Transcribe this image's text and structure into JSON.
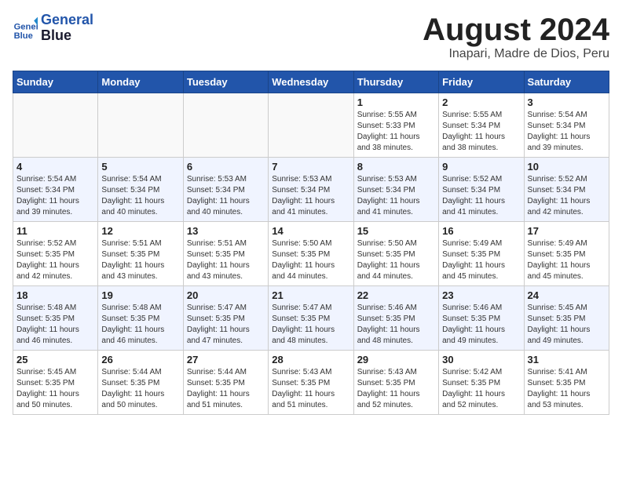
{
  "header": {
    "logo_line1": "General",
    "logo_line2": "Blue",
    "month_title": "August 2024",
    "subtitle": "Inapari, Madre de Dios, Peru"
  },
  "weekdays": [
    "Sunday",
    "Monday",
    "Tuesday",
    "Wednesday",
    "Thursday",
    "Friday",
    "Saturday"
  ],
  "weeks": [
    [
      {
        "day": "",
        "info": ""
      },
      {
        "day": "",
        "info": ""
      },
      {
        "day": "",
        "info": ""
      },
      {
        "day": "",
        "info": ""
      },
      {
        "day": "1",
        "info": "Sunrise: 5:55 AM\nSunset: 5:33 PM\nDaylight: 11 hours\nand 38 minutes."
      },
      {
        "day": "2",
        "info": "Sunrise: 5:55 AM\nSunset: 5:34 PM\nDaylight: 11 hours\nand 38 minutes."
      },
      {
        "day": "3",
        "info": "Sunrise: 5:54 AM\nSunset: 5:34 PM\nDaylight: 11 hours\nand 39 minutes."
      }
    ],
    [
      {
        "day": "4",
        "info": "Sunrise: 5:54 AM\nSunset: 5:34 PM\nDaylight: 11 hours\nand 39 minutes."
      },
      {
        "day": "5",
        "info": "Sunrise: 5:54 AM\nSunset: 5:34 PM\nDaylight: 11 hours\nand 40 minutes."
      },
      {
        "day": "6",
        "info": "Sunrise: 5:53 AM\nSunset: 5:34 PM\nDaylight: 11 hours\nand 40 minutes."
      },
      {
        "day": "7",
        "info": "Sunrise: 5:53 AM\nSunset: 5:34 PM\nDaylight: 11 hours\nand 41 minutes."
      },
      {
        "day": "8",
        "info": "Sunrise: 5:53 AM\nSunset: 5:34 PM\nDaylight: 11 hours\nand 41 minutes."
      },
      {
        "day": "9",
        "info": "Sunrise: 5:52 AM\nSunset: 5:34 PM\nDaylight: 11 hours\nand 41 minutes."
      },
      {
        "day": "10",
        "info": "Sunrise: 5:52 AM\nSunset: 5:34 PM\nDaylight: 11 hours\nand 42 minutes."
      }
    ],
    [
      {
        "day": "11",
        "info": "Sunrise: 5:52 AM\nSunset: 5:35 PM\nDaylight: 11 hours\nand 42 minutes."
      },
      {
        "day": "12",
        "info": "Sunrise: 5:51 AM\nSunset: 5:35 PM\nDaylight: 11 hours\nand 43 minutes."
      },
      {
        "day": "13",
        "info": "Sunrise: 5:51 AM\nSunset: 5:35 PM\nDaylight: 11 hours\nand 43 minutes."
      },
      {
        "day": "14",
        "info": "Sunrise: 5:50 AM\nSunset: 5:35 PM\nDaylight: 11 hours\nand 44 minutes."
      },
      {
        "day": "15",
        "info": "Sunrise: 5:50 AM\nSunset: 5:35 PM\nDaylight: 11 hours\nand 44 minutes."
      },
      {
        "day": "16",
        "info": "Sunrise: 5:49 AM\nSunset: 5:35 PM\nDaylight: 11 hours\nand 45 minutes."
      },
      {
        "day": "17",
        "info": "Sunrise: 5:49 AM\nSunset: 5:35 PM\nDaylight: 11 hours\nand 45 minutes."
      }
    ],
    [
      {
        "day": "18",
        "info": "Sunrise: 5:48 AM\nSunset: 5:35 PM\nDaylight: 11 hours\nand 46 minutes."
      },
      {
        "day": "19",
        "info": "Sunrise: 5:48 AM\nSunset: 5:35 PM\nDaylight: 11 hours\nand 46 minutes."
      },
      {
        "day": "20",
        "info": "Sunrise: 5:47 AM\nSunset: 5:35 PM\nDaylight: 11 hours\nand 47 minutes."
      },
      {
        "day": "21",
        "info": "Sunrise: 5:47 AM\nSunset: 5:35 PM\nDaylight: 11 hours\nand 48 minutes."
      },
      {
        "day": "22",
        "info": "Sunrise: 5:46 AM\nSunset: 5:35 PM\nDaylight: 11 hours\nand 48 minutes."
      },
      {
        "day": "23",
        "info": "Sunrise: 5:46 AM\nSunset: 5:35 PM\nDaylight: 11 hours\nand 49 minutes."
      },
      {
        "day": "24",
        "info": "Sunrise: 5:45 AM\nSunset: 5:35 PM\nDaylight: 11 hours\nand 49 minutes."
      }
    ],
    [
      {
        "day": "25",
        "info": "Sunrise: 5:45 AM\nSunset: 5:35 PM\nDaylight: 11 hours\nand 50 minutes."
      },
      {
        "day": "26",
        "info": "Sunrise: 5:44 AM\nSunset: 5:35 PM\nDaylight: 11 hours\nand 50 minutes."
      },
      {
        "day": "27",
        "info": "Sunrise: 5:44 AM\nSunset: 5:35 PM\nDaylight: 11 hours\nand 51 minutes."
      },
      {
        "day": "28",
        "info": "Sunrise: 5:43 AM\nSunset: 5:35 PM\nDaylight: 11 hours\nand 51 minutes."
      },
      {
        "day": "29",
        "info": "Sunrise: 5:43 AM\nSunset: 5:35 PM\nDaylight: 11 hours\nand 52 minutes."
      },
      {
        "day": "30",
        "info": "Sunrise: 5:42 AM\nSunset: 5:35 PM\nDaylight: 11 hours\nand 52 minutes."
      },
      {
        "day": "31",
        "info": "Sunrise: 5:41 AM\nSunset: 5:35 PM\nDaylight: 11 hours\nand 53 minutes."
      }
    ]
  ]
}
